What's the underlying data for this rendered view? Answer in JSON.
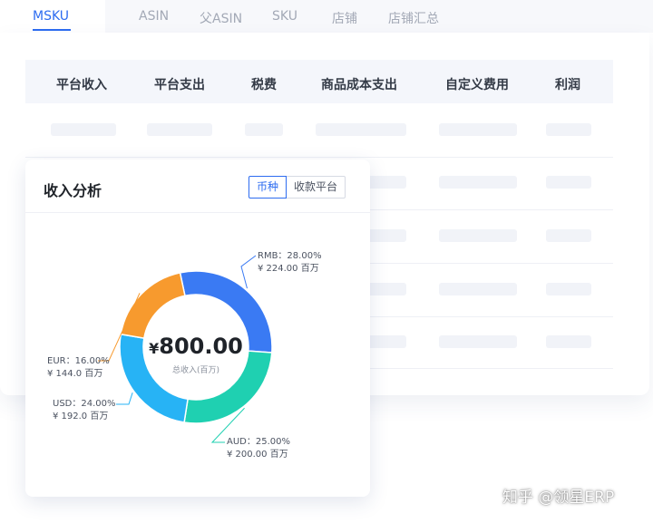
{
  "tabs": [
    {
      "label": "MSKU",
      "active": true
    },
    {
      "label": "ASIN",
      "active": false
    },
    {
      "label": "父ASIN",
      "active": false
    },
    {
      "label": "SKU",
      "active": false
    },
    {
      "label": "店铺",
      "active": false
    },
    {
      "label": "店铺汇总",
      "active": false
    }
  ],
  "table": {
    "columns": [
      "平台收入",
      "平台支出",
      "税费",
      "商品成本支出",
      "自定义费用",
      "利润"
    ]
  },
  "card": {
    "title": "收入分析",
    "toggle": {
      "options": [
        "币种",
        "收款平台"
      ],
      "selected": "币种"
    },
    "center": {
      "currency": "¥",
      "amount": "800.00",
      "caption": "总收入(百万)"
    }
  },
  "chart_data": {
    "type": "pie",
    "donut": true,
    "categories": [
      "RMB",
      "AUD",
      "USD",
      "EUR"
    ],
    "values": [
      224,
      200,
      192,
      144
    ],
    "percent_labels": [
      "RMB：28.00%",
      "AUD：25.00%",
      "USD：24.00%",
      "EUR：16.00%"
    ],
    "value_labels": [
      "¥ 224.00 百万",
      "¥ 200.00 百万",
      "¥ 192.0 百万",
      "¥ 144.0 百万"
    ],
    "colors": [
      "#3a7af3",
      "#1fd0b1",
      "#27b3f5",
      "#f79a2e"
    ]
  },
  "watermark": "知乎 @领星ERP"
}
